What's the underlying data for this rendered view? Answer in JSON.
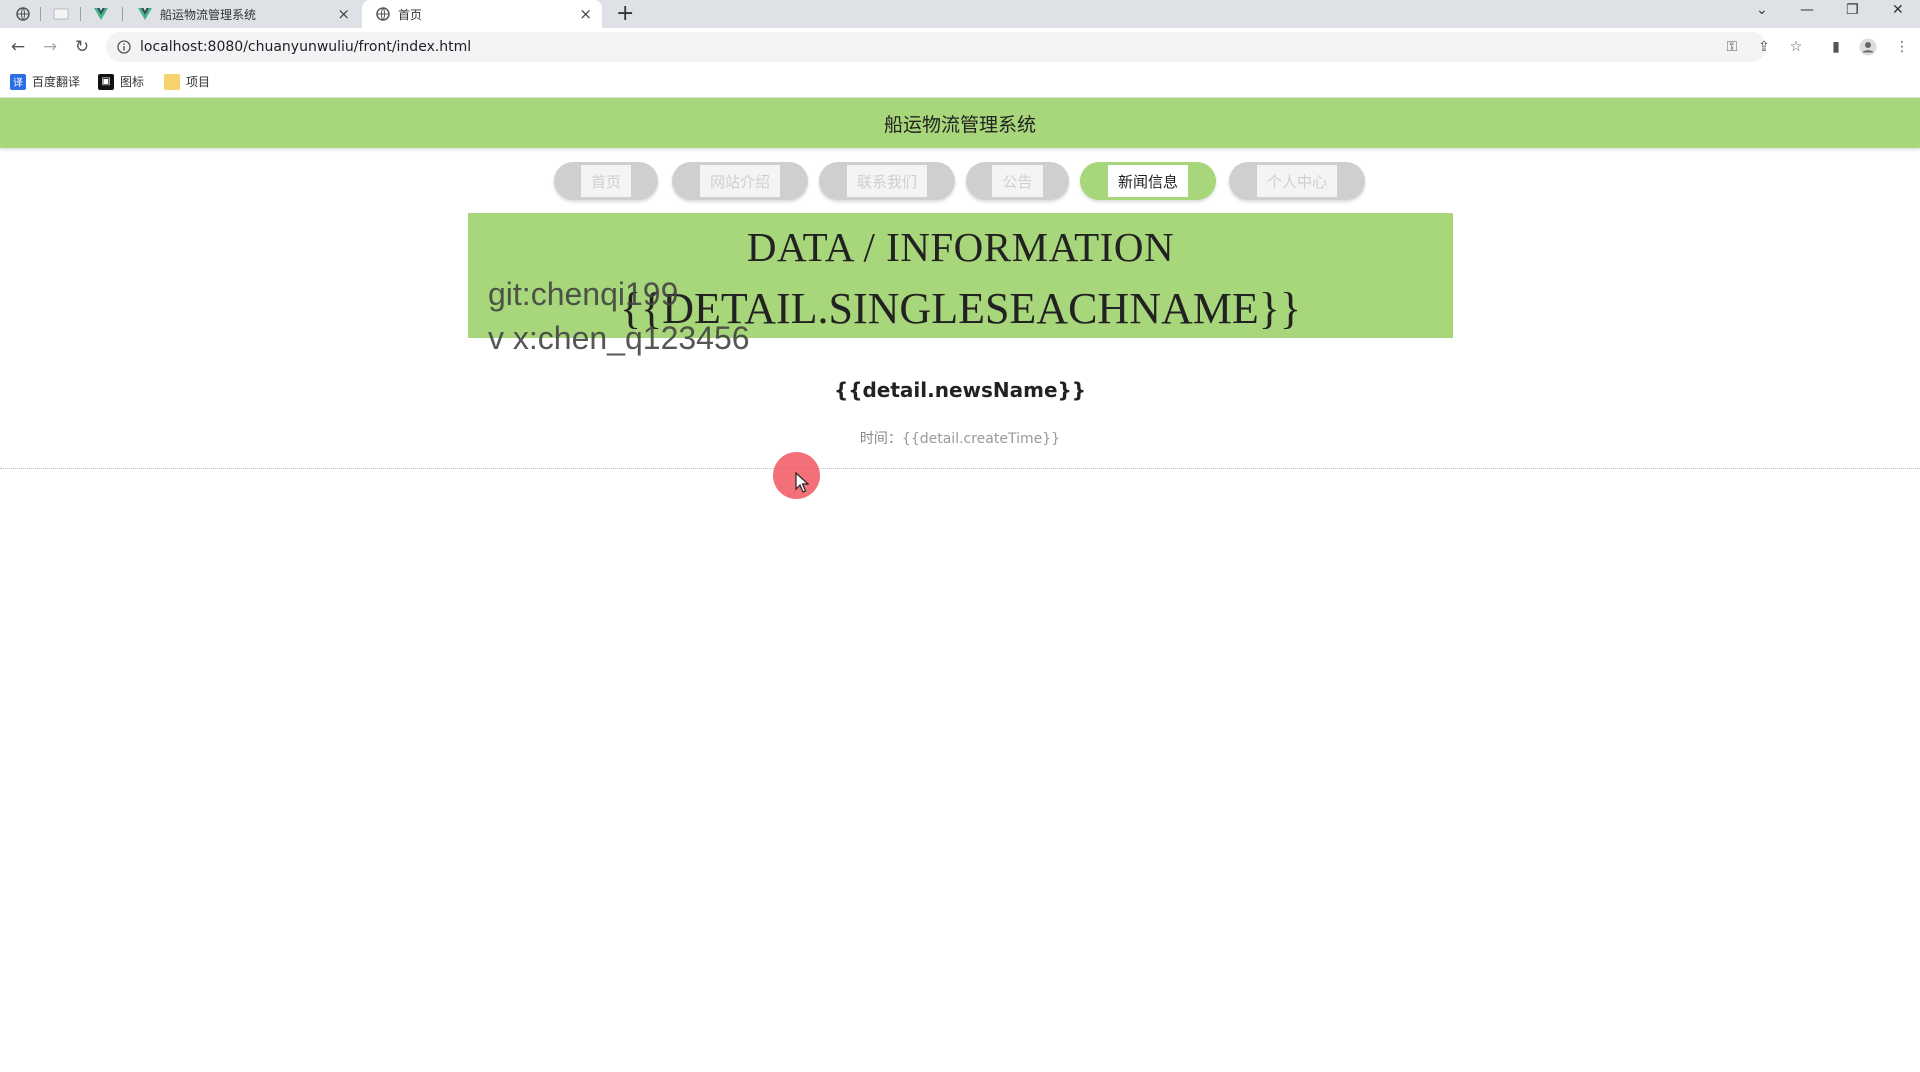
{
  "browser": {
    "tabs": [
      {
        "title": "船运物流管理系统",
        "active": false
      },
      {
        "title": "首页",
        "active": true
      }
    ],
    "new_tab": "+",
    "url": "localhost:8080/chuanyunwuliu/front/index.html",
    "bookmarks": [
      {
        "label": "百度翻译",
        "icon": "translate-icon"
      },
      {
        "label": "图标",
        "icon": "image-icon"
      },
      {
        "label": "项目",
        "icon": "folder-icon"
      }
    ]
  },
  "site": {
    "title": "船运物流管理系统"
  },
  "nav": {
    "items": [
      {
        "label": "首页",
        "active": false
      },
      {
        "label": "网站介绍",
        "active": false
      },
      {
        "label": "联系我们",
        "active": false
      },
      {
        "label": "公告",
        "active": false
      },
      {
        "label": "新闻信息",
        "active": true
      },
      {
        "label": "个人中心",
        "active": false
      }
    ]
  },
  "banner": {
    "title": "DATA / INFORMATION",
    "subtitle": "{{DETAIL.SINGLESEACHNAME}}"
  },
  "watermark": {
    "line1": "git:chenqi199",
    "line2": "v x:chen_q123456"
  },
  "detail": {
    "news_name": "{{detail.newsName}}",
    "time_label": "时间：",
    "time_value": "{{detail.createTime}}"
  },
  "colors": {
    "accent": "#a8d67a",
    "cursor": "#f0505a"
  }
}
